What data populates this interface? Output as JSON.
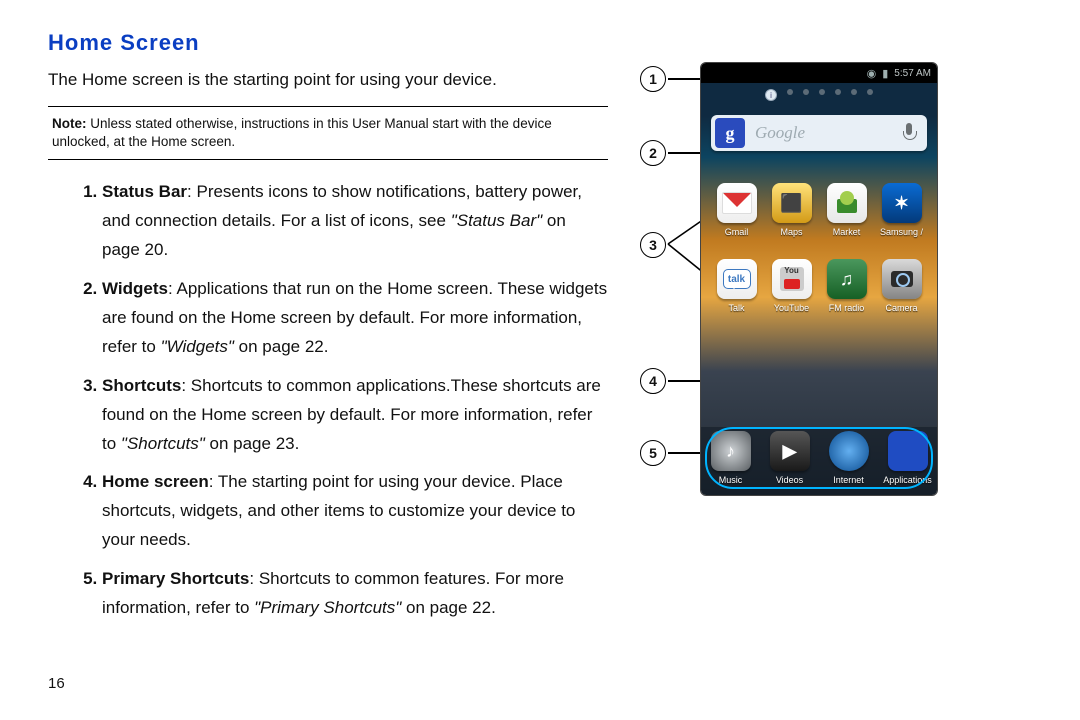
{
  "title": "Home Screen",
  "intro": "The Home screen is the starting point for using your device.",
  "note_prefix": "Note:",
  "note_body": " Unless stated otherwise, instructions in this User Manual start with the device unlocked, at the Home screen.",
  "items": [
    {
      "term": "Status Bar",
      "body_a": ": Presents icons to show notifications, battery power, and connection details. For a list of icons, see ",
      "ref": "\"Status Bar\"",
      "body_b": " on page 20."
    },
    {
      "term": "Widgets",
      "body_a": ": Applications that run on the Home screen. These widgets are found on the Home screen by default. For more information, refer to ",
      "ref": "\"Widgets\"",
      "body_b": "  on page 22."
    },
    {
      "term": "Shortcuts",
      "body_a": ": Shortcuts to common applications.These shortcuts are found on the Home screen by default. For more information, refer to ",
      "ref": "\"Shortcuts\"",
      "body_b": "  on page 23."
    },
    {
      "term": "Home screen",
      "body_a": ": The starting point for using your device. Place shortcuts, widgets, and other items to customize your device to your needs.",
      "ref": "",
      "body_b": ""
    },
    {
      "term": "Primary Shortcuts",
      "body_a": ": Shortcuts to common features. For more information, refer to ",
      "ref": "\"Primary Shortcuts\"",
      "body_b": "  on page 22."
    }
  ],
  "page_number": "16",
  "callouts": [
    "1",
    "2",
    "3",
    "4",
    "5"
  ],
  "statusbar": {
    "time": "5:57 AM"
  },
  "search": {
    "logo": "g",
    "placeholder": "Google"
  },
  "apps_row1": [
    {
      "name": "gmail",
      "label": "Gmail"
    },
    {
      "name": "maps",
      "label": "Maps"
    },
    {
      "name": "market",
      "label": "Market"
    },
    {
      "name": "samsung",
      "label": "Samsung /"
    }
  ],
  "apps_row2": [
    {
      "name": "talk",
      "label": "Talk",
      "text": "talk"
    },
    {
      "name": "youtube",
      "label": "YouTube"
    },
    {
      "name": "fmradio",
      "label": "FM radio"
    },
    {
      "name": "camera",
      "label": "Camera"
    }
  ],
  "dock": [
    {
      "name": "music",
      "label": "Music"
    },
    {
      "name": "videos",
      "label": "Videos"
    },
    {
      "name": "internet",
      "label": "Internet"
    },
    {
      "name": "applications",
      "label": "Applications"
    }
  ]
}
